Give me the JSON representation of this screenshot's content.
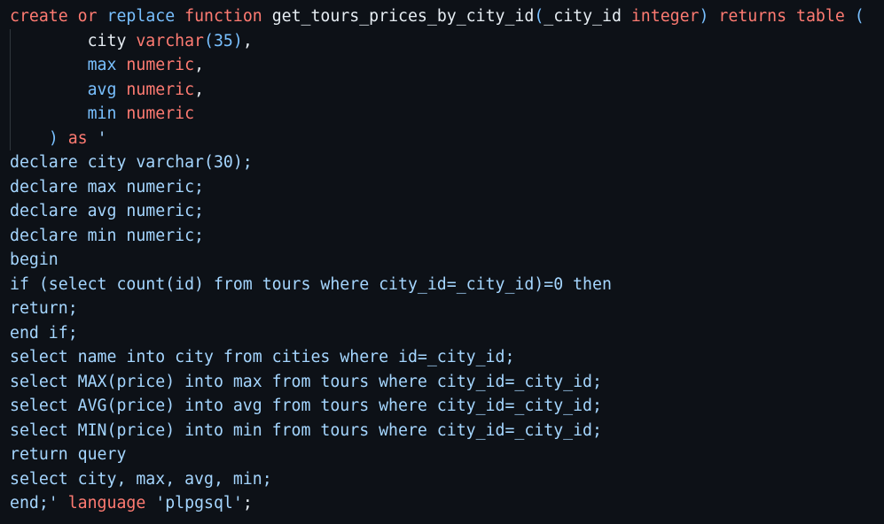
{
  "colors": {
    "background": "#0d1117",
    "keyword": "#ff7b72",
    "identifier": "#79c0ff",
    "plain": "#e6edf3",
    "string": "#a5d6ff",
    "indent_guide": "#30363d"
  },
  "lines": [
    [
      {
        "t": "create",
        "c": "kw"
      },
      {
        "t": " ",
        "c": "pl"
      },
      {
        "t": "or",
        "c": "kw"
      },
      {
        "t": " ",
        "c": "pl"
      },
      {
        "t": "replace",
        "c": "blu"
      },
      {
        "t": " ",
        "c": "pl"
      },
      {
        "t": "function",
        "c": "kw"
      },
      {
        "t": " ",
        "c": "pl"
      },
      {
        "t": "get_tours_prices_by_city_id",
        "c": "pl"
      },
      {
        "t": "(",
        "c": "blu"
      },
      {
        "t": "_city_id ",
        "c": "pl"
      },
      {
        "t": "integer",
        "c": "kw"
      },
      {
        "t": ")",
        "c": "blu"
      },
      {
        "t": " ",
        "c": "pl"
      },
      {
        "t": "returns",
        "c": "kw"
      },
      {
        "t": " ",
        "c": "pl"
      },
      {
        "t": "table",
        "c": "kw"
      },
      {
        "t": " ",
        "c": "pl"
      },
      {
        "t": "(",
        "c": "blu"
      }
    ],
    [
      {
        "t": "        city ",
        "c": "pl"
      },
      {
        "t": "varchar",
        "c": "kw"
      },
      {
        "t": "(",
        "c": "blu"
      },
      {
        "t": "35",
        "c": "num"
      },
      {
        "t": ")",
        "c": "blu"
      },
      {
        "t": ",",
        "c": "pl"
      }
    ],
    [
      {
        "t": "        ",
        "c": "pl"
      },
      {
        "t": "max",
        "c": "blu"
      },
      {
        "t": " ",
        "c": "pl"
      },
      {
        "t": "numeric",
        "c": "kw"
      },
      {
        "t": ",",
        "c": "pl"
      }
    ],
    [
      {
        "t": "        ",
        "c": "pl"
      },
      {
        "t": "avg",
        "c": "blu"
      },
      {
        "t": " ",
        "c": "pl"
      },
      {
        "t": "numeric",
        "c": "kw"
      },
      {
        "t": ",",
        "c": "pl"
      }
    ],
    [
      {
        "t": "        ",
        "c": "pl"
      },
      {
        "t": "min",
        "c": "blu"
      },
      {
        "t": " ",
        "c": "pl"
      },
      {
        "t": "numeric",
        "c": "kw"
      }
    ],
    [
      {
        "t": "    ",
        "c": "pl"
      },
      {
        "t": ")",
        "c": "blu"
      },
      {
        "t": " ",
        "c": "pl"
      },
      {
        "t": "as",
        "c": "kw"
      },
      {
        "t": " ",
        "c": "pl"
      },
      {
        "t": "'",
        "c": "str"
      }
    ],
    [
      {
        "t": "declare city varchar(30);",
        "c": "str"
      }
    ],
    [
      {
        "t": "declare max numeric;",
        "c": "str"
      }
    ],
    [
      {
        "t": "declare avg numeric;",
        "c": "str"
      }
    ],
    [
      {
        "t": "declare min numeric;",
        "c": "str"
      }
    ],
    [
      {
        "t": "begin",
        "c": "str"
      }
    ],
    [
      {
        "t": "if (select count(id) from tours where city_id=_city_id)=0 then",
        "c": "str"
      }
    ],
    [
      {
        "t": "return;",
        "c": "str"
      }
    ],
    [
      {
        "t": "end if;",
        "c": "str"
      }
    ],
    [
      {
        "t": "select name into city from cities where id=_city_id;",
        "c": "str"
      }
    ],
    [
      {
        "t": "select MAX(price) into max from tours where city_id=_city_id;",
        "c": "str"
      }
    ],
    [
      {
        "t": "select AVG(price) into avg from tours where city_id=_city_id;",
        "c": "str"
      }
    ],
    [
      {
        "t": "select MIN(price) into min from tours where city_id=_city_id;",
        "c": "str"
      }
    ],
    [
      {
        "t": "return query",
        "c": "str"
      }
    ],
    [
      {
        "t": "select city, max, avg, min;",
        "c": "str"
      }
    ],
    [
      {
        "t": "end;'",
        "c": "str"
      },
      {
        "t": " ",
        "c": "pl"
      },
      {
        "t": "language",
        "c": "kw"
      },
      {
        "t": " ",
        "c": "pl"
      },
      {
        "t": "'plpgsql'",
        "c": "str"
      },
      {
        "t": ";",
        "c": "pl"
      }
    ]
  ],
  "indent_guide_lines": [
    1,
    2,
    3,
    4,
    5
  ]
}
